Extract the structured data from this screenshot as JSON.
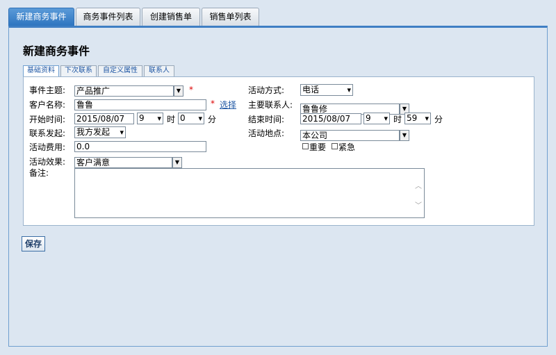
{
  "top_tabs": [
    {
      "label": "新建商务事件",
      "active": true
    },
    {
      "label": "商务事件列表",
      "active": false
    },
    {
      "label": "创建销售单",
      "active": false
    },
    {
      "label": "销售单列表",
      "active": false
    }
  ],
  "page_title": "新建商务事件",
  "sub_tabs": [
    {
      "label": "基础资料",
      "active": true
    },
    {
      "label": "下次联系",
      "active": false
    },
    {
      "label": "自定义属性",
      "active": false
    },
    {
      "label": "联系人",
      "active": false
    }
  ],
  "form": {
    "subject": {
      "label": "事件主题:",
      "value": "产品推广",
      "required_mark": "*"
    },
    "customer": {
      "label": "客户名称:",
      "value": "鲁鲁",
      "required_mark": "*",
      "select_link": "选择"
    },
    "start_time": {
      "label": "开始时间:",
      "date": "2015/08/07",
      "hour": "9",
      "hour_unit": "时",
      "minute": "0",
      "minute_unit": "分"
    },
    "contact_initiator": {
      "label": "联系发起:",
      "value": "我方发起"
    },
    "cost": {
      "label": "活动费用:",
      "value": "0.0"
    },
    "effect": {
      "label": "活动效果:",
      "value": "客户满意"
    },
    "notes": {
      "label": "备注:",
      "value": ""
    },
    "activity_method": {
      "label": "活动方式:",
      "value": "电话"
    },
    "main_contact": {
      "label": "主要联系人:",
      "value": "鲁鲁修"
    },
    "end_time": {
      "label": "结束时间:",
      "date": "2015/08/07",
      "hour": "9",
      "hour_unit": "时",
      "minute": "59",
      "minute_unit": "分"
    },
    "location": {
      "label": "活动地点:",
      "value": "本公司"
    },
    "important": {
      "label": "重要",
      "checked": false
    },
    "urgent": {
      "label": "紧急",
      "checked": false
    }
  },
  "save_label": "保存"
}
